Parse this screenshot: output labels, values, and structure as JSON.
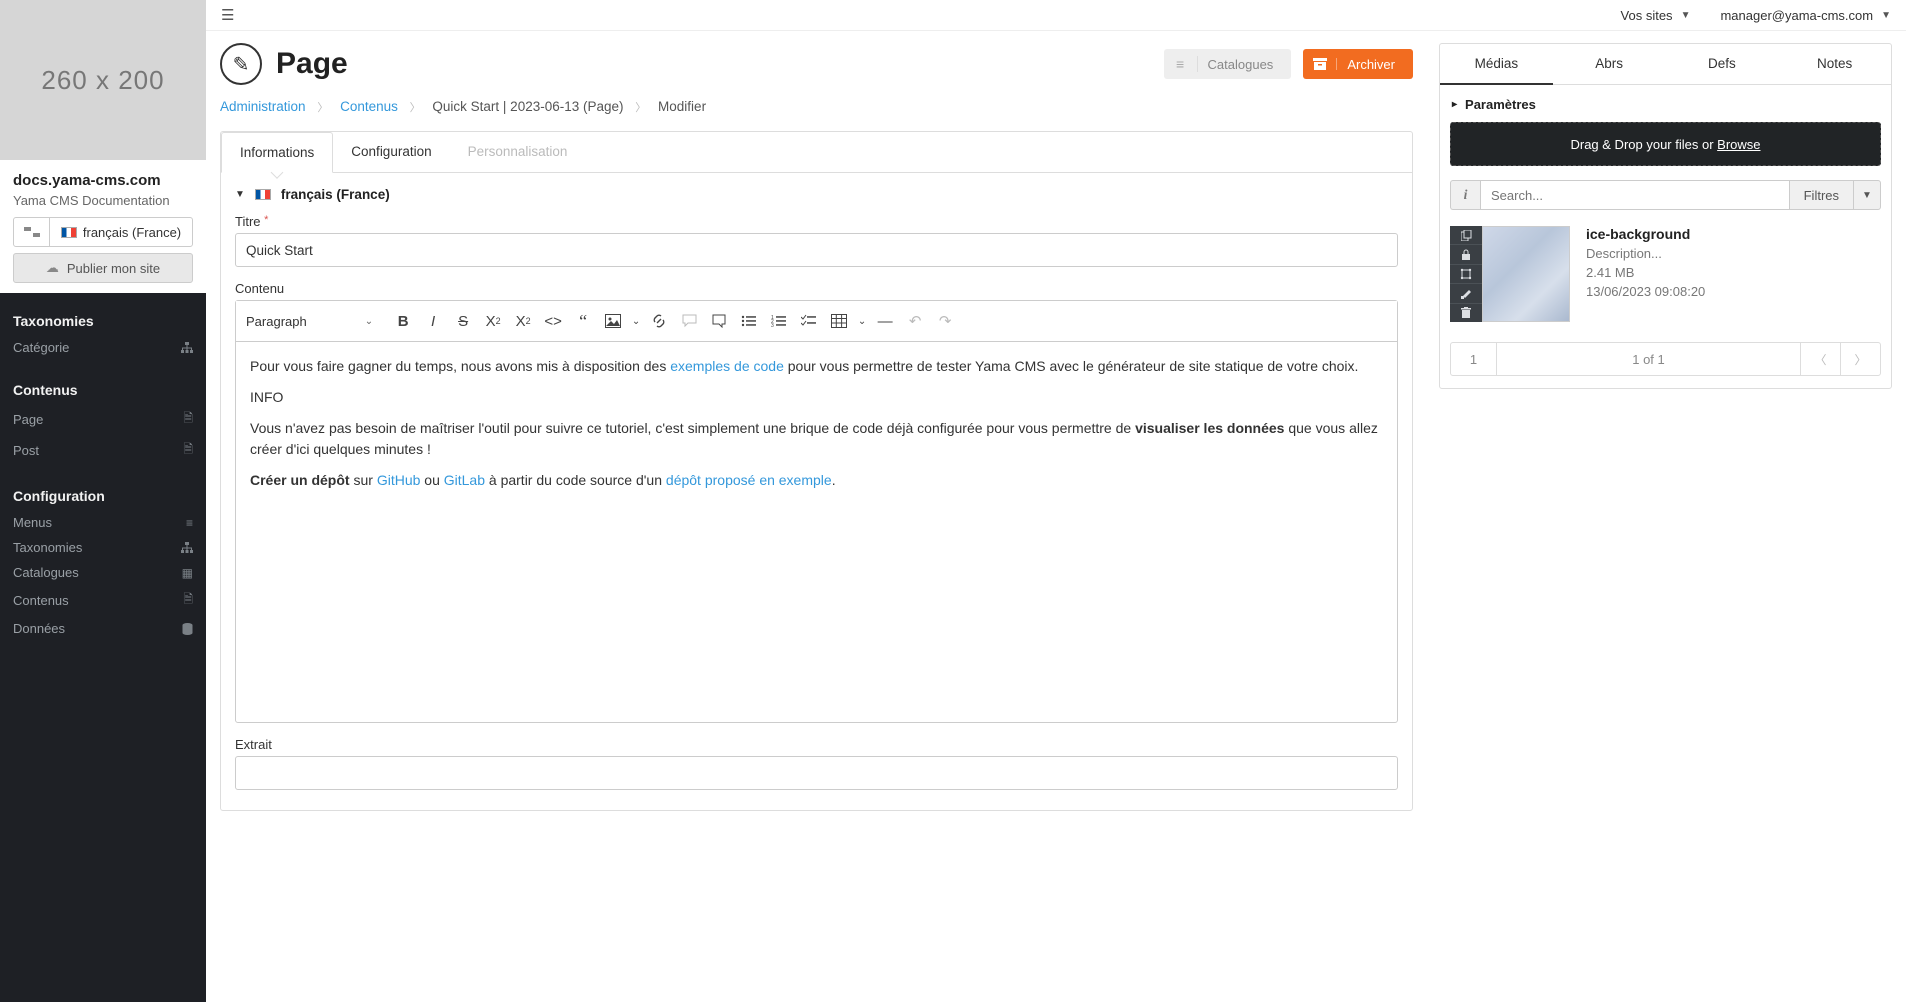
{
  "sidebar": {
    "logo_placeholder": "260 x 200",
    "site_name": "docs.yama-cms.com",
    "site_desc": "Yama CMS Documentation",
    "lang_label": "français (France)",
    "publish_label": "Publier mon site",
    "sections": [
      {
        "title": "Taxonomies",
        "items": [
          {
            "label": "Catégorie",
            "icon": "sitemap"
          }
        ]
      },
      {
        "title": "Contenus",
        "items": [
          {
            "label": "Page",
            "icon": "file"
          },
          {
            "label": "Post",
            "icon": "file"
          }
        ]
      },
      {
        "title": "Configuration",
        "items": [
          {
            "label": "Menus",
            "icon": "list"
          },
          {
            "label": "Taxonomies",
            "icon": "sitemap"
          },
          {
            "label": "Catalogues",
            "icon": "grid"
          },
          {
            "label": "Contenus",
            "icon": "file"
          },
          {
            "label": "Données",
            "icon": "database"
          }
        ]
      }
    ]
  },
  "topbar": {
    "sites_label": "Vos sites",
    "user_email": "manager@yama-cms.com"
  },
  "page": {
    "title": "Page",
    "btn_catalogues": "Catalogues",
    "btn_archiver": "Archiver"
  },
  "breadcrumbs": {
    "a1": "Administration",
    "a2": "Contenus",
    "t3": "Quick Start | 2023-06-13 (Page)",
    "t4": "Modifier"
  },
  "tabs": {
    "info": "Informations",
    "config": "Configuration",
    "perso": "Personnalisation"
  },
  "form": {
    "collapse_label": "français (France)",
    "titre_label": "Titre",
    "titre_value": "Quick Start",
    "contenu_label": "Contenu",
    "paragraph_label": "Paragraph",
    "extrait_label": "Extrait"
  },
  "editor": {
    "p1a": "Pour vous faire gagner du temps, nous avons mis à disposition des ",
    "p1link": "exemples de code",
    "p1b": " pour vous permettre de tester Yama CMS avec le générateur de site statique de votre choix.",
    "p2": "INFO",
    "p3a": "Vous n'avez pas besoin de maîtriser l'outil pour suivre ce tutoriel, c'est simplement une brique de code déjà configurée pour vous permettre de ",
    "p3bold": "visualiser les données",
    "p3b": " que vous allez créer d'ici quelques minutes !",
    "p4bold": "Créer un dépôt",
    "p4a": " sur ",
    "p4link1": "GitHub",
    "p4b": " ou ",
    "p4link2": "GitLab",
    "p4c": " à partir du code source d'un ",
    "p4link3": "dépôt proposé en exemple",
    "p4d": "."
  },
  "right": {
    "tabs": {
      "medias": "Médias",
      "abrs": "Abrs",
      "defs": "Defs",
      "notes": "Notes"
    },
    "params": "Paramètres",
    "drop_text": "Drag & Drop your files or ",
    "drop_link": "Browse",
    "search_placeholder": "Search...",
    "filters": "Filtres",
    "media": {
      "title": "ice-background",
      "desc": "Description...",
      "size": "2.41 MB",
      "date": "13/06/2023 09:08:20"
    },
    "pager": {
      "page": "1",
      "info": "1 of 1"
    }
  }
}
